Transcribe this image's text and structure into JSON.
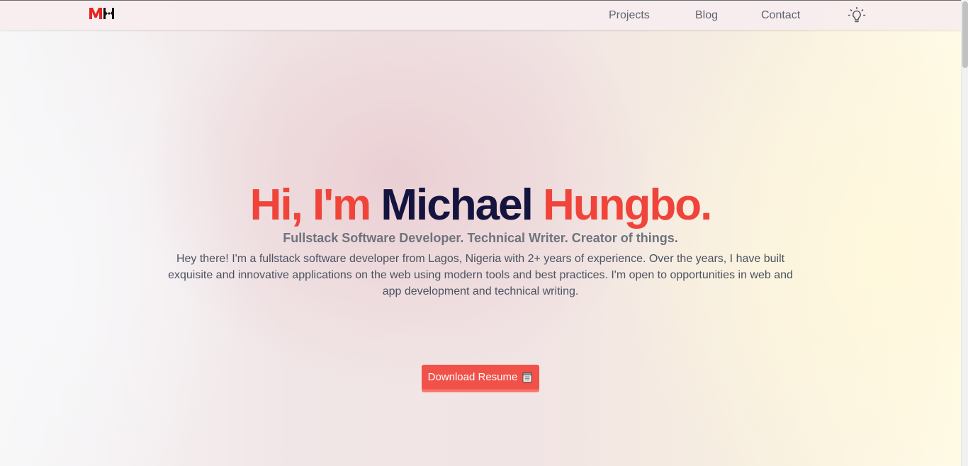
{
  "nav": {
    "logo_alt": "MH",
    "links": {
      "projects": "Projects",
      "blog": "Blog",
      "contact": "Contact"
    },
    "theme_toggle_icon": "lightbulb-icon"
  },
  "hero": {
    "greeting": "Hi, I'm",
    "first_name": "Michael",
    "last_name": "Hungbo.",
    "subtitle": "Fullstack Software Developer. Technical Writer. Creator of things.",
    "description": "Hey there! I'm a fullstack software developer from Lagos, Nigeria with 2+ years of experience. Over the years, I have built exquisite and innovative applications on the web using modern tools and best practices. I'm open to opportunities in web and app development and technical writing.",
    "resume_button": "Download Resume",
    "resume_icon": "document-icon"
  },
  "colors": {
    "accent": "#f0443a",
    "dark": "#14143f",
    "button": "#f0524a",
    "nav_text": "#5f6470"
  }
}
